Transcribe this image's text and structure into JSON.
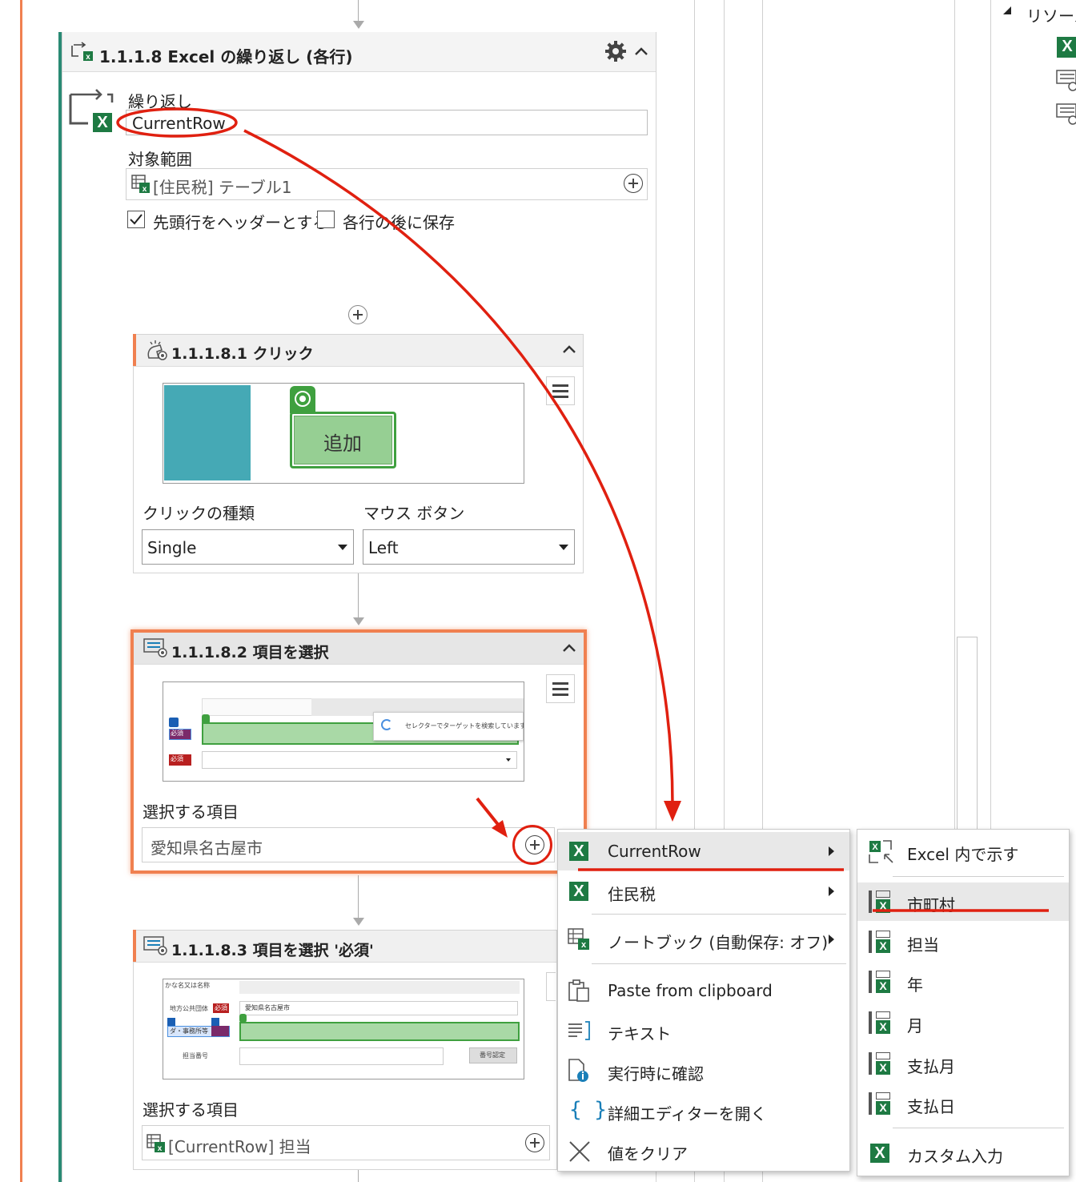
{
  "loop": {
    "title": "1.1.1.8 Excel の繰り返し (各行)",
    "repeat_label": "繰り返し",
    "repeat_value": "CurrentRow",
    "range_label": "対象範囲",
    "range_value": "[住民税] テーブル1",
    "header_checkbox_label": "先頭行をヘッダーとする",
    "save_checkbox_label": "各行の後に保存"
  },
  "click_step": {
    "title": "1.1.1.8.1 クリック",
    "button_preview_label": "追加",
    "click_type_label": "クリックの種類",
    "click_type_value": "Single",
    "mouse_button_label": "マウス ボタン",
    "mouse_button_value": "Left"
  },
  "select_step_2": {
    "title": "1.1.1.8.2 項目を選択",
    "preview_status": "セレクターでターゲットを検索しています。",
    "preview_badge_required": "必須",
    "item_label": "選択する項目",
    "item_value": "愛知県名古屋市"
  },
  "select_step_3": {
    "title": "1.1.1.8.3 項目を選択 '必須'",
    "preview_row1_label": "かな名又は名称",
    "preview_row2_label": "地方公共団体",
    "preview_row2_badge": "必須",
    "preview_row2_value": "愛知県名古屋市",
    "preview_row3_label": "ダ・事務所等",
    "preview_row4_label": "担当番号",
    "preview_button": "番号認定",
    "item_label": "選択する項目",
    "item_value": "[CurrentRow] 担当"
  },
  "resources": {
    "title": "リソース"
  },
  "menu_main": {
    "items": [
      {
        "label": "CurrentRow",
        "icon": "excel-icon",
        "submenu": true
      },
      {
        "label": "住民税",
        "icon": "excel-icon",
        "submenu": true
      },
      {
        "label": "ノートブック (自動保存: オフ)",
        "icon": "excel-table-icon",
        "submenu": true
      },
      {
        "label": "Paste from clipboard",
        "icon": "clipboard-icon",
        "submenu": false
      },
      {
        "label": "テキスト",
        "icon": "text-icon",
        "submenu": false
      },
      {
        "label": "実行時に確認",
        "icon": "document-info-icon",
        "submenu": false
      },
      {
        "label": "詳細エディターを開く",
        "icon": "braces-icon",
        "submenu": false
      },
      {
        "label": "値をクリア",
        "icon": "clear-x-icon",
        "submenu": false
      }
    ]
  },
  "menu_sub": {
    "items": [
      {
        "label": "Excel 内で示す",
        "icon": "excel-indicate-icon"
      },
      {
        "label": "市町村",
        "icon": "column-icon"
      },
      {
        "label": "担当",
        "icon": "column-icon"
      },
      {
        "label": "年",
        "icon": "column-icon"
      },
      {
        "label": "月",
        "icon": "column-icon"
      },
      {
        "label": "支払月",
        "icon": "column-icon"
      },
      {
        "label": "支払日",
        "icon": "column-icon"
      },
      {
        "label": "カスタム入力",
        "icon": "excel-icon"
      }
    ]
  },
  "colors": {
    "accent_orange": "#f08050",
    "excel_green": "#1e7a43",
    "annotation_red": "#e02010",
    "loop_bar_teal": "#2a8a74"
  }
}
